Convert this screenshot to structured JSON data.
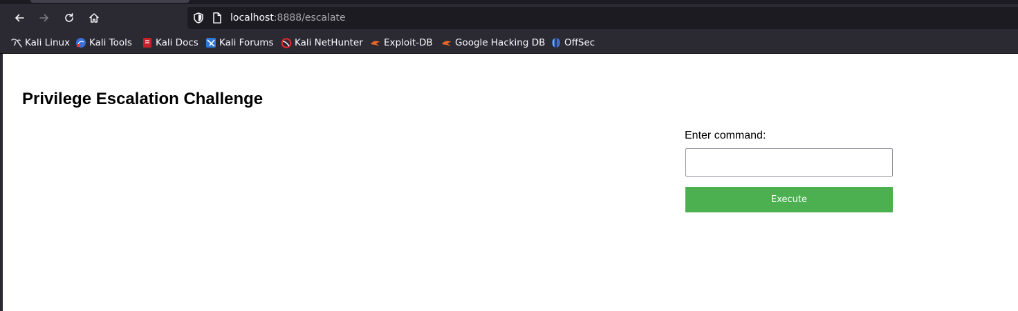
{
  "browser": {
    "url_host": "localhost",
    "url_rest": ":8888/escalate",
    "toolbar_bg": "#2b2a33",
    "urlbar_bg": "#1c1b22"
  },
  "bookmarks": [
    {
      "label": "Kali Linux",
      "icon": "kali-dragon-icon"
    },
    {
      "label": "Kali Tools",
      "icon": "kali-tools-icon"
    },
    {
      "label": "Kali Docs",
      "icon": "kali-docs-icon"
    },
    {
      "label": "Kali Forums",
      "icon": "kali-forums-icon"
    },
    {
      "label": "Kali NetHunter",
      "icon": "kali-nethunter-icon"
    },
    {
      "label": "Exploit-DB",
      "icon": "exploit-db-icon"
    },
    {
      "label": "Google Hacking DB",
      "icon": "google-hacking-db-icon"
    },
    {
      "label": "OffSec",
      "icon": "offsec-icon"
    }
  ],
  "page": {
    "title": "Privilege Escalation Challenge",
    "command_label": "Enter command:",
    "command_value": "",
    "execute_label": "Execute",
    "button_color": "#4caf50"
  }
}
